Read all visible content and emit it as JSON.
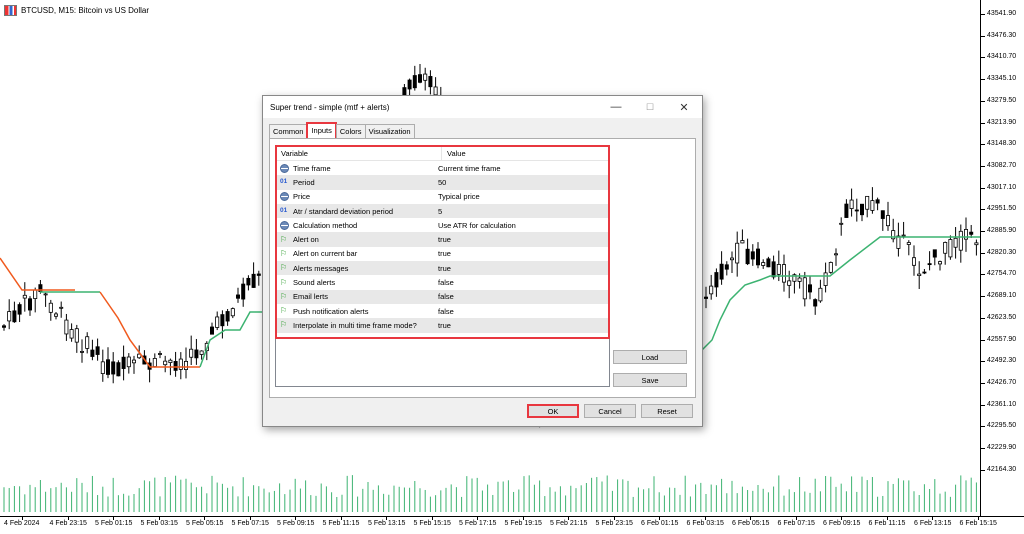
{
  "chart": {
    "title": "BTCUSD, M15:  Bitcoin vs US Dollar",
    "price_labels": [
      "43541.90",
      "43476.30",
      "43410.70",
      "43345.10",
      "43279.50",
      "43213.90",
      "43148.30",
      "43082.70",
      "43017.10",
      "42951.50",
      "42885.90",
      "42820.30",
      "42754.70",
      "42689.10",
      "42623.50",
      "42557.90",
      "42492.30",
      "42426.70",
      "42361.10",
      "42295.50",
      "42229.90",
      "42164.30"
    ],
    "time_labels": [
      "4 Feb 2024",
      "4 Feb 23:15",
      "5 Feb 01:15",
      "5 Feb 03:15",
      "5 Feb 05:15",
      "5 Feb 07:15",
      "5 Feb 09:15",
      "5 Feb 11:15",
      "5 Feb 13:15",
      "5 Feb 15:15",
      "5 Feb 17:15",
      "5 Feb 19:15",
      "5 Feb 21:15",
      "5 Feb 23:15",
      "6 Feb 01:15",
      "6 Feb 03:15",
      "6 Feb 05:15",
      "6 Feb 07:15",
      "6 Feb 09:15",
      "6 Feb 11:15",
      "6 Feb 13:15",
      "6 Feb 15:15"
    ],
    "colors": {
      "down_trend": "#f05a1e",
      "up_trend": "#3cb371",
      "candle": "#000000",
      "volume": "#3cb371"
    }
  },
  "dialog": {
    "title": "Super trend - simple (mtf + alerts)",
    "window_controls": {
      "minimize": "—",
      "maximize": "☐",
      "close": "✕"
    },
    "tabs": [
      {
        "label": "Common"
      },
      {
        "label": "Inputs"
      },
      {
        "label": "Colors"
      },
      {
        "label": "Visualization"
      }
    ],
    "active_tab": "Inputs",
    "table": {
      "headers": {
        "variable": "Variable",
        "value": "Value"
      },
      "rows": [
        {
          "icon": "enum",
          "variable": "Time frame",
          "value": "Current time frame"
        },
        {
          "icon": "num",
          "variable": "Period",
          "value": "50"
        },
        {
          "icon": "enum",
          "variable": "Price",
          "value": "Typical price"
        },
        {
          "icon": "num",
          "variable": "Atr / standard deviation period",
          "value": "5"
        },
        {
          "icon": "enum",
          "variable": "Calculation method",
          "value": "Use ATR for calculation"
        },
        {
          "icon": "flag",
          "variable": "Alert on",
          "value": "true"
        },
        {
          "icon": "flag",
          "variable": "Alert on current bar",
          "value": "true"
        },
        {
          "icon": "flag",
          "variable": "Alerts messages",
          "value": "true"
        },
        {
          "icon": "flag",
          "variable": "Sound alerts",
          "value": "false"
        },
        {
          "icon": "flag",
          "variable": "Email lerts",
          "value": "false"
        },
        {
          "icon": "flag",
          "variable": "Push notification alerts",
          "value": "false"
        },
        {
          "icon": "flag",
          "variable": "Interpolate in multi time frame mode?",
          "value": "true"
        }
      ]
    },
    "buttons": {
      "load": "Load",
      "save": "Save",
      "ok": "OK",
      "cancel": "Cancel",
      "reset": "Reset"
    },
    "highlight_color": "#e8373f"
  }
}
